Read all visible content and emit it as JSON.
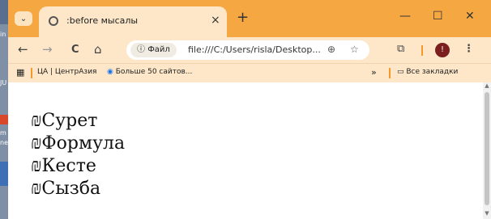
{
  "desktop": {
    "text_top": "in",
    "text_mid": "JU",
    "text_low1": "m",
    "text_low2": "ne"
  },
  "browser": {
    "tab_title": ":before мысалы",
    "tab_close": "×",
    "new_tab": "+",
    "window_controls": {
      "minimize": "—",
      "maximize": "☐",
      "close": "✕"
    },
    "nav": {
      "back": "←",
      "forward": "→",
      "reload": "C",
      "home": "⌂"
    },
    "address": {
      "chip_label": "Файл",
      "url": "file:///C:/Users/risla/Desktop..."
    },
    "bookmarks": {
      "item1": "ЦА | ЦентрАзия",
      "item2": "Больше 50 сайтов...",
      "more": "»",
      "all_bookmarks": "Все закладки"
    }
  },
  "page": {
    "items": [
      "₪Сурет",
      "₪Формула",
      "₪Кесте",
      "₪Сызба"
    ]
  },
  "colors": {
    "titlebar": "#f5a742",
    "toolbar": "#fde7c8",
    "accent": "#f59a2a"
  }
}
